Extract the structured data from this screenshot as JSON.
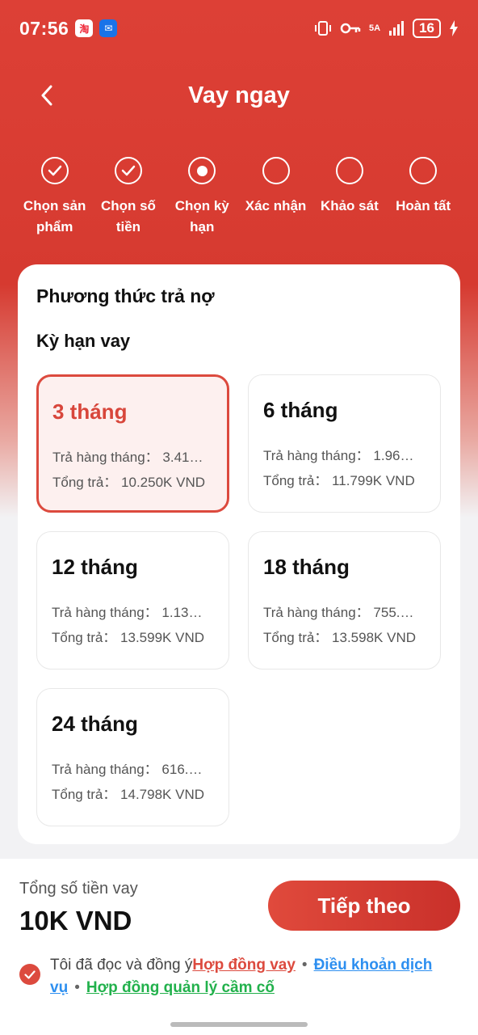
{
  "status_bar": {
    "time": "07:56",
    "network": "5A",
    "battery": "16"
  },
  "header": {
    "title": "Vay ngay"
  },
  "stepper": {
    "steps": [
      {
        "label": "Chọn sản phẩm",
        "state": "done"
      },
      {
        "label": "Chọn số tiền",
        "state": "done"
      },
      {
        "label": "Chọn kỳ hạn",
        "state": "current"
      },
      {
        "label": "Xác nhận",
        "state": "todo"
      },
      {
        "label": "Khảo sát",
        "state": "todo"
      },
      {
        "label": "Hoàn tất",
        "state": "todo"
      }
    ]
  },
  "card": {
    "section_title": "Phương thức trả nợ",
    "sub_title": "Kỳ hạn vay",
    "options": [
      {
        "term": "3 tháng",
        "monthly_label": "Trả hàng tháng：",
        "monthly_value": "3.41…",
        "total_label": "Tổng trả：",
        "total_value": "10.250K VND",
        "selected": true
      },
      {
        "term": "6 tháng",
        "monthly_label": "Trả hàng tháng：",
        "monthly_value": "1.96…",
        "total_label": "Tổng trả：",
        "total_value": "11.799K VND",
        "selected": false
      },
      {
        "term": "12 tháng",
        "monthly_label": "Trả hàng tháng：",
        "monthly_value": "1.13…",
        "total_label": "Tổng trả：",
        "total_value": "13.599K VND",
        "selected": false
      },
      {
        "term": "18 tháng",
        "monthly_label": "Trả hàng tháng：",
        "monthly_value": "755.…",
        "total_label": "Tổng trả：",
        "total_value": "13.598K VND",
        "selected": false
      },
      {
        "term": "24 tháng",
        "monthly_label": "Trả hàng tháng：",
        "monthly_value": "616.…",
        "total_label": "Tổng trả：",
        "total_value": "14.798K VND",
        "selected": false
      }
    ]
  },
  "bottom": {
    "total_label": "Tổng số tiền vay",
    "total_value": "10K VND",
    "next_button": "Tiếp theo",
    "agree_prefix": "Tôi đã đọc và đồng ý",
    "link_contract": "Hợp đồng vay",
    "link_terms": "Điều khoản dịch vụ",
    "link_pawn": "Hợp đồng quản lý cầm cố",
    "separator": "•"
  },
  "colors": {
    "primary": "#dc4a3e",
    "link_blue": "#2d8ff0",
    "link_green": "#22b14c"
  },
  "icons": [
    "back-arrow-icon",
    "check-icon",
    "vibrate-icon",
    "key-icon",
    "signal-icon",
    "charging-icon"
  ]
}
